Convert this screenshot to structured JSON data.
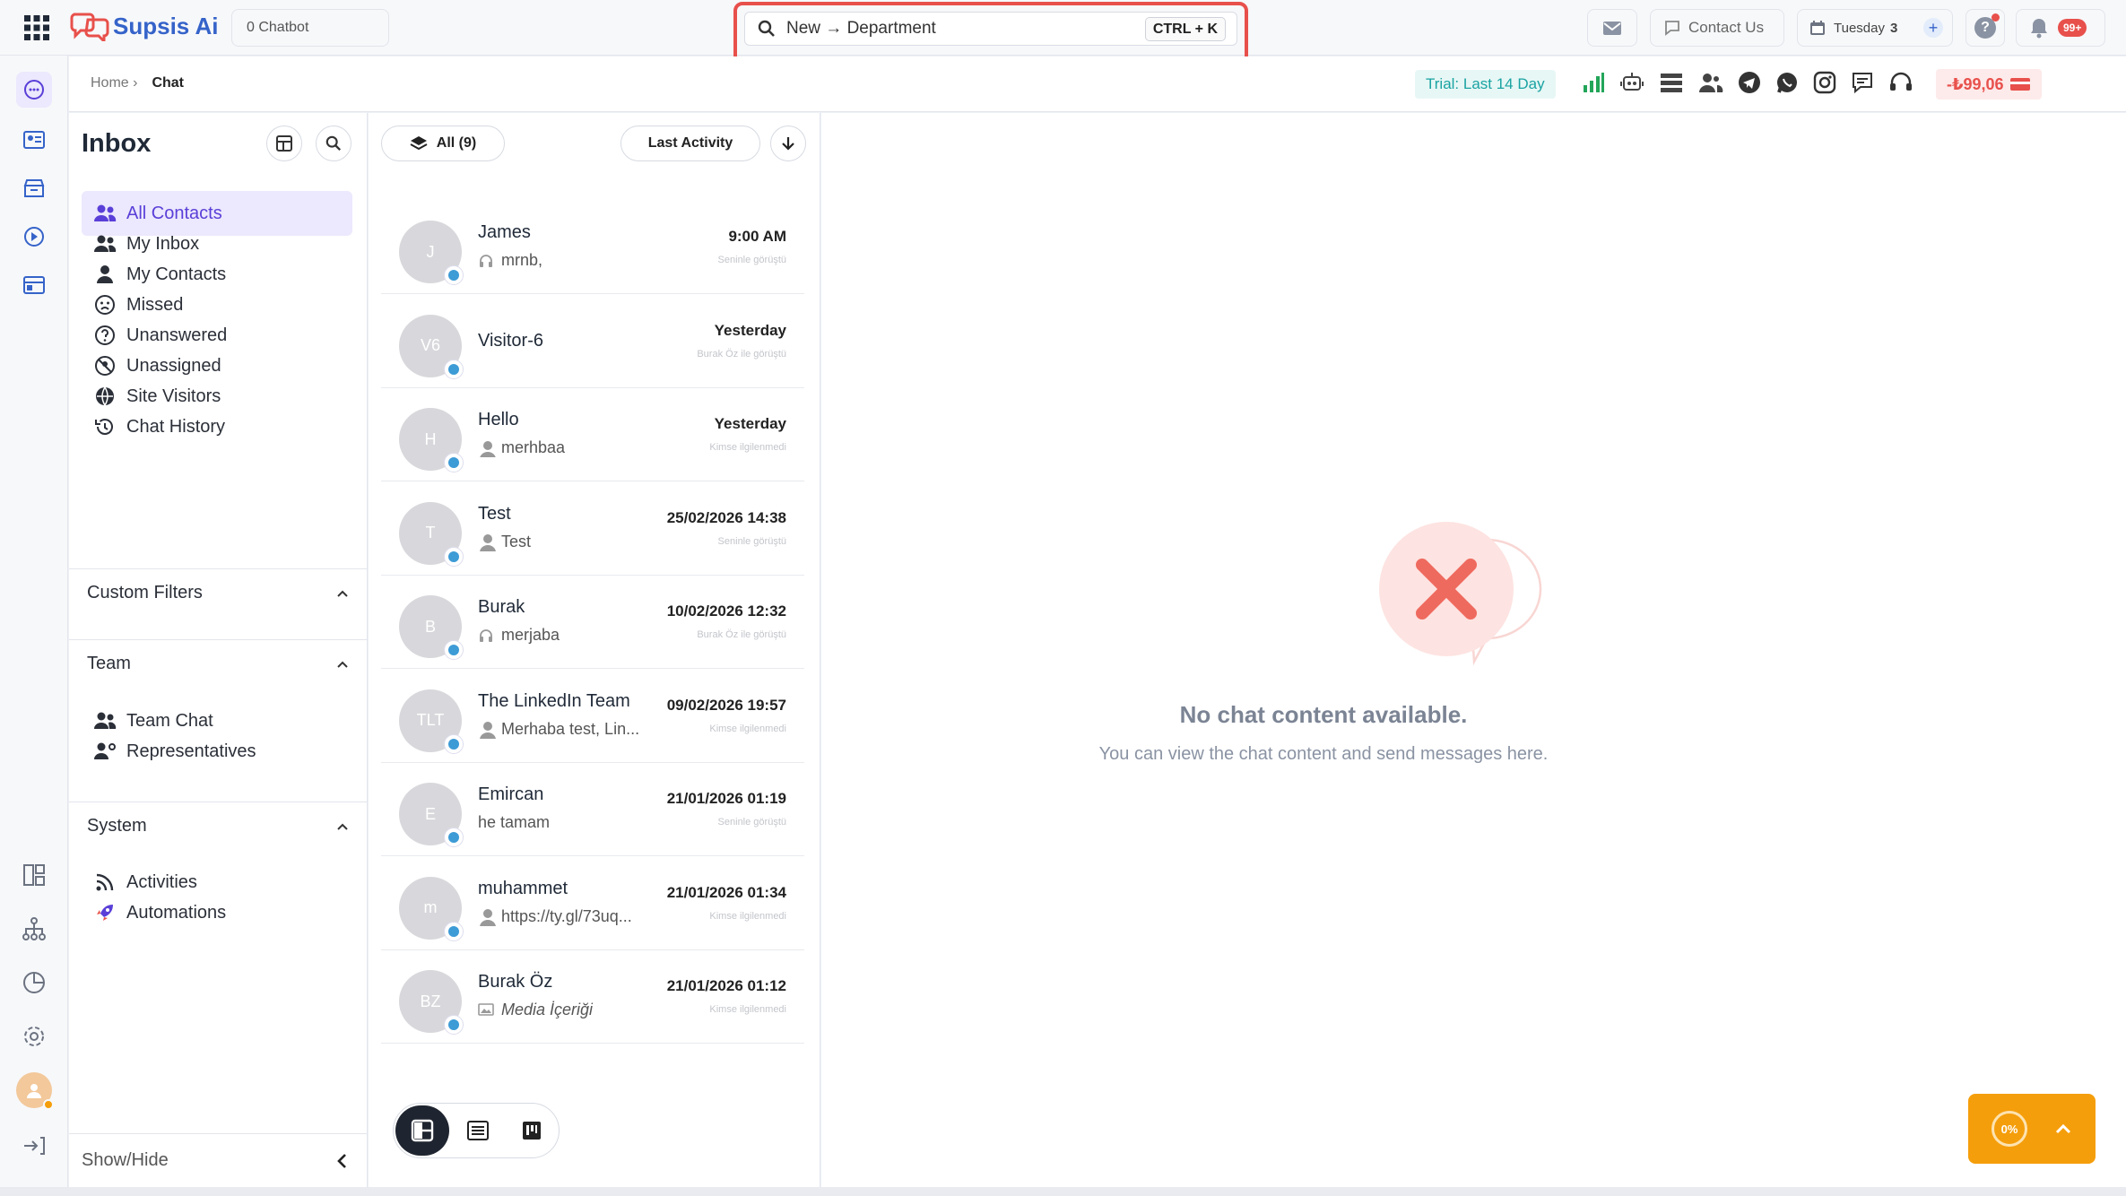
{
  "app": {
    "name": "Supsis Ai"
  },
  "topbar": {
    "chatbot_label": "0 Chatbot",
    "search_value": "New → Department",
    "shortcut": "CTRL + K",
    "contact_us": "Contact Us",
    "day_label": "Tuesday",
    "day_number": "3",
    "notifications_badge": "99+"
  },
  "breadcrumb": {
    "home": "Home ›",
    "current": "Chat"
  },
  "status": {
    "trial": "Trial: Last 14 Day",
    "balance": "-₺99,06"
  },
  "inbox": {
    "title": "Inbox",
    "items": [
      {
        "label": "All Contacts",
        "icon": "users-icon"
      },
      {
        "label": "My Inbox",
        "icon": "users-icon"
      },
      {
        "label": "My Contacts",
        "icon": "user-icon"
      },
      {
        "label": "Missed",
        "icon": "sad-face-icon"
      },
      {
        "label": "Unanswered",
        "icon": "question-circle-icon"
      },
      {
        "label": "Unassigned",
        "icon": "slash-circle-icon"
      },
      {
        "label": "Site Visitors",
        "icon": "globe-icon"
      },
      {
        "label": "Chat History",
        "icon": "history-icon"
      }
    ],
    "custom_filters": "Custom Filters",
    "team_title": "Team",
    "team_items": [
      {
        "label": "Team Chat",
        "icon": "users-icon"
      },
      {
        "label": "Representatives",
        "icon": "user-cog-icon"
      }
    ],
    "system_title": "System",
    "system_items": [
      {
        "label": "Activities",
        "icon": "rss-icon"
      },
      {
        "label": "Automations",
        "icon": "rocket-icon"
      }
    ],
    "show_hide": "Show/Hide"
  },
  "convlist": {
    "filter_all": "All (9)",
    "sort_label": "Last Activity",
    "conversations": [
      {
        "initials": "J",
        "name": "James",
        "message": "mrnb,",
        "time": "9:00 AM",
        "status": "Seninle görüştü",
        "msg_icon": "headset-icon"
      },
      {
        "initials": "V6",
        "name": "Visitor-6",
        "message": "",
        "time": "Yesterday",
        "status": "Burak Öz ile görüştü",
        "msg_icon": ""
      },
      {
        "initials": "H",
        "name": "Hello",
        "message": "merhbaa",
        "time": "Yesterday",
        "status": "Kimse ilgilenmedi",
        "msg_icon": "user-icon"
      },
      {
        "initials": "T",
        "name": "Test",
        "message": "Test",
        "time": "25/02/2026 14:38",
        "status": "Seninle görüştü",
        "msg_icon": "user-icon"
      },
      {
        "initials": "B",
        "name": "Burak",
        "message": "merjaba",
        "time": "10/02/2026 12:32",
        "status": "Burak Öz ile görüştü",
        "msg_icon": "headset-icon"
      },
      {
        "initials": "TLT",
        "name": "The LinkedIn Team",
        "message": "Merhaba test, Lin...",
        "time": "09/02/2026 19:57",
        "status": "Kimse ilgilenmedi",
        "msg_icon": "user-icon"
      },
      {
        "initials": "E",
        "name": "Emircan",
        "message": "he tamam",
        "time": "21/01/2026 01:19",
        "status": "Seninle görüştü",
        "msg_icon": ""
      },
      {
        "initials": "m",
        "name": "muhammet",
        "message": "https://ty.gl/73uq...",
        "time": "21/01/2026 01:34",
        "status": "Kimse ilgilenmedi",
        "msg_icon": "user-icon"
      },
      {
        "initials": "BZ",
        "name": "Burak Öz",
        "message": "Media İçeriği",
        "time": "21/01/2026 01:12",
        "status": "Kimse ilgilenmedi",
        "msg_icon": "image-icon"
      }
    ]
  },
  "empty_state": {
    "title": "No chat content available.",
    "subtitle": "You can view the chat content and send messages here."
  },
  "progress_widget": {
    "percent_label": "0%"
  },
  "colors": {
    "accent": "#5a3fd8",
    "danger": "#e8504b",
    "orange": "#f5a623",
    "trial": "#1aa3a3"
  }
}
